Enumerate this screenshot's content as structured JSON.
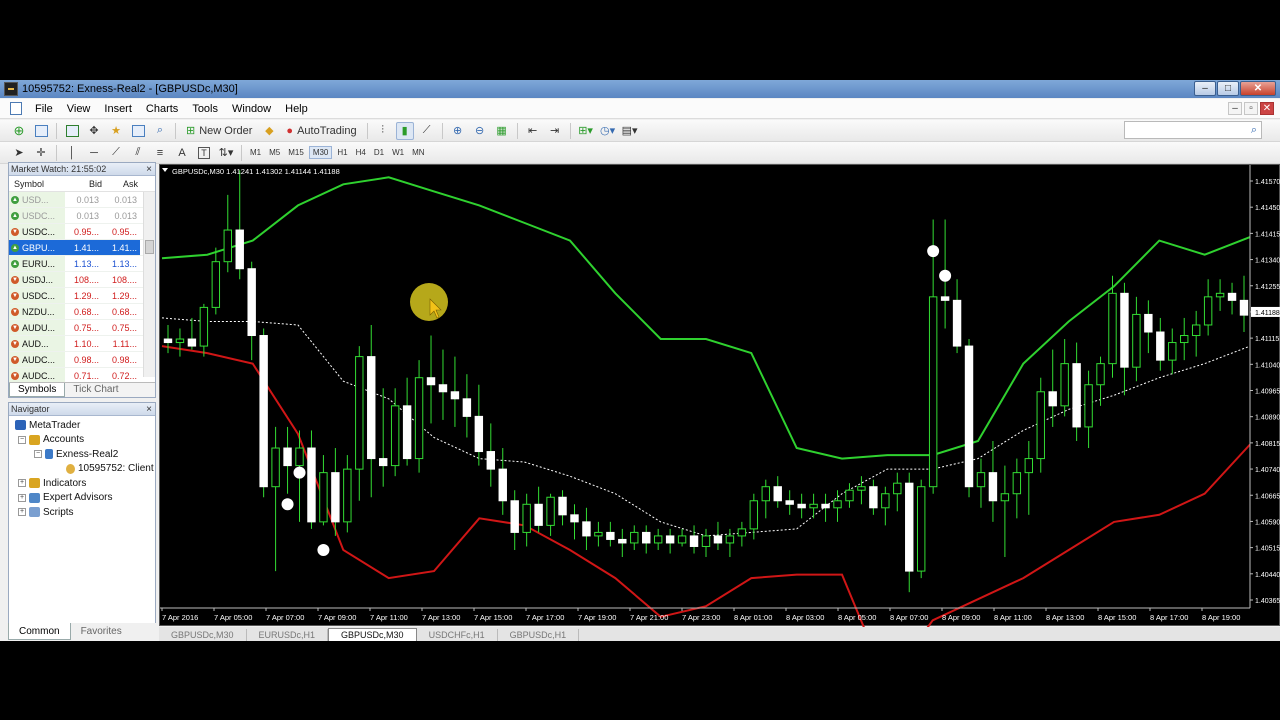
{
  "window": {
    "title": "10595752: Exness-Real2 - [GBPUSDc,M30]"
  },
  "menu": [
    "File",
    "View",
    "Insert",
    "Charts",
    "Tools",
    "Window",
    "Help"
  ],
  "toolbar": {
    "new_order": "New Order",
    "autotrading": "AutoTrading",
    "search_placeholder": ""
  },
  "timeframes": [
    "M1",
    "M5",
    "M15",
    "M30",
    "H1",
    "H4",
    "D1",
    "W1",
    "MN"
  ],
  "active_timeframe": "M30",
  "draw_tools": {
    "text": "A",
    "label": "T"
  },
  "market_watch": {
    "title": "Market Watch: 21:55:02",
    "columns": [
      "Symbol",
      "Bid",
      "Ask"
    ],
    "rows": [
      {
        "symbol": "USD...",
        "bid": "0.013",
        "ask": "0.013",
        "dir": "up",
        "dim": true
      },
      {
        "symbol": "USDC...",
        "bid": "0.013",
        "ask": "0.013",
        "dir": "up",
        "dim": true
      },
      {
        "symbol": "USDC...",
        "bid": "0.95...",
        "ask": "0.95...",
        "dir": "dn"
      },
      {
        "symbol": "GBPU...",
        "bid": "1.41...",
        "ask": "1.41...",
        "dir": "up",
        "selected": true
      },
      {
        "symbol": "EURU...",
        "bid": "1.13...",
        "ask": "1.13...",
        "dir": "up"
      },
      {
        "symbol": "USDJ...",
        "bid": "108....",
        "ask": "108....",
        "dir": "dn"
      },
      {
        "symbol": "USDC...",
        "bid": "1.29...",
        "ask": "1.29...",
        "dir": "dn"
      },
      {
        "symbol": "NZDU...",
        "bid": "0.68...",
        "ask": "0.68...",
        "dir": "dn"
      },
      {
        "symbol": "AUDU...",
        "bid": "0.75...",
        "ask": "0.75...",
        "dir": "dn"
      },
      {
        "symbol": "AUD...",
        "bid": "1.10...",
        "ask": "1.11...",
        "dir": "dn"
      },
      {
        "symbol": "AUDC...",
        "bid": "0.98...",
        "ask": "0.98...",
        "dir": "dn"
      },
      {
        "symbol": "AUDC...",
        "bid": "0.71...",
        "ask": "0.72...",
        "dir": "dn"
      }
    ],
    "tabs": [
      "Symbols",
      "Tick Chart"
    ]
  },
  "navigator": {
    "title": "Navigator",
    "items": [
      "MetaTrader",
      "Accounts",
      "Exness-Real2",
      "10595752: Client",
      "Indicators",
      "Expert Advisors",
      "Scripts"
    ]
  },
  "bottom_tabs": [
    "Common",
    "Favorites"
  ],
  "chart_tabs": [
    "GBPUSDc,M30",
    "EURUSDc,H1",
    "GBPUSDc,M30",
    "USDCHFc,H1",
    "GBPUSDc,H1"
  ],
  "active_chart_tab": 2,
  "chart_data": {
    "type": "candlestick",
    "symbol": "GBPUSDc,M30",
    "header": "GBPUSDc,M30  1.41241 1.41302 1.41144 1.41188",
    "current_price": "1.41188",
    "ylim": [
      1.40355,
      1.41615
    ],
    "y_ticks": [
      "1.41570",
      "1.41450",
      "1.41415",
      "1.41340",
      "1.41255",
      "1.41188",
      "1.41115",
      "1.41040",
      "1.40965",
      "1.40890",
      "1.40815",
      "1.40740",
      "1.40665",
      "1.40590",
      "1.40515",
      "1.40440",
      "1.40365"
    ],
    "x_ticks": [
      "7 Apr 2016",
      "7 Apr 05:00",
      "7 Apr 07:00",
      "7 Apr 09:00",
      "7 Apr 11:00",
      "7 Apr 13:00",
      "7 Apr 15:00",
      "7 Apr 17:00",
      "7 Apr 19:00",
      "7 Apr 21:00",
      "7 Apr 23:00",
      "8 Apr 01:00",
      "8 Apr 03:00",
      "8 Apr 05:00",
      "8 Apr 07:00",
      "8 Apr 09:00",
      "8 Apr 11:00",
      "8 Apr 13:00",
      "8 Apr 15:00",
      "8 Apr 17:00",
      "8 Apr 19:00"
    ],
    "candles": [
      {
        "o": 1.4112,
        "h": 1.4116,
        "l": 1.4108,
        "c": 1.4111
      },
      {
        "o": 1.4111,
        "h": 1.4115,
        "l": 1.4107,
        "c": 1.4112
      },
      {
        "o": 1.4112,
        "h": 1.4118,
        "l": 1.4109,
        "c": 1.411
      },
      {
        "o": 1.411,
        "h": 1.4122,
        "l": 1.4107,
        "c": 1.4121
      },
      {
        "o": 1.4121,
        "h": 1.4138,
        "l": 1.4119,
        "c": 1.4134
      },
      {
        "o": 1.4134,
        "h": 1.4153,
        "l": 1.4131,
        "c": 1.4143
      },
      {
        "o": 1.4143,
        "h": 1.416,
        "l": 1.4129,
        "c": 1.4132
      },
      {
        "o": 1.4132,
        "h": 1.4134,
        "l": 1.4106,
        "c": 1.4113
      },
      {
        "o": 1.4113,
        "h": 1.4115,
        "l": 1.4067,
        "c": 1.407
      },
      {
        "o": 1.407,
        "h": 1.4087,
        "l": 1.4046,
        "c": 1.4081
      },
      {
        "o": 1.4081,
        "h": 1.4087,
        "l": 1.4068,
        "c": 1.4076
      },
      {
        "o": 1.4076,
        "h": 1.4086,
        "l": 1.406,
        "c": 1.4081
      },
      {
        "o": 1.4081,
        "h": 1.4086,
        "l": 1.4058,
        "c": 1.406
      },
      {
        "o": 1.406,
        "h": 1.4079,
        "l": 1.4059,
        "c": 1.4074
      },
      {
        "o": 1.4074,
        "h": 1.4081,
        "l": 1.4056,
        "c": 1.406
      },
      {
        "o": 1.406,
        "h": 1.4079,
        "l": 1.4057,
        "c": 1.4075
      },
      {
        "o": 1.4075,
        "h": 1.411,
        "l": 1.4066,
        "c": 1.4107
      },
      {
        "o": 1.4107,
        "h": 1.4116,
        "l": 1.4067,
        "c": 1.4078
      },
      {
        "o": 1.4078,
        "h": 1.4098,
        "l": 1.407,
        "c": 1.4076
      },
      {
        "o": 1.4076,
        "h": 1.4098,
        "l": 1.4073,
        "c": 1.4093
      },
      {
        "o": 1.4093,
        "h": 1.4101,
        "l": 1.4076,
        "c": 1.4078
      },
      {
        "o": 1.4078,
        "h": 1.4106,
        "l": 1.4074,
        "c": 1.4101
      },
      {
        "o": 1.4101,
        "h": 1.4113,
        "l": 1.4088,
        "c": 1.4099
      },
      {
        "o": 1.4099,
        "h": 1.4109,
        "l": 1.4089,
        "c": 1.4097
      },
      {
        "o": 1.4097,
        "h": 1.4107,
        "l": 1.4087,
        "c": 1.4095
      },
      {
        "o": 1.4095,
        "h": 1.4102,
        "l": 1.4084,
        "c": 1.409
      },
      {
        "o": 1.409,
        "h": 1.4099,
        "l": 1.4076,
        "c": 1.408
      },
      {
        "o": 1.408,
        "h": 1.4088,
        "l": 1.407,
        "c": 1.4075
      },
      {
        "o": 1.4075,
        "h": 1.4081,
        "l": 1.4062,
        "c": 1.4066
      },
      {
        "o": 1.4066,
        "h": 1.4069,
        "l": 1.4052,
        "c": 1.4057
      },
      {
        "o": 1.4057,
        "h": 1.4068,
        "l": 1.4053,
        "c": 1.4065
      },
      {
        "o": 1.4065,
        "h": 1.407,
        "l": 1.4057,
        "c": 1.4059
      },
      {
        "o": 1.4059,
        "h": 1.4068,
        "l": 1.4056,
        "c": 1.4067
      },
      {
        "o": 1.4067,
        "h": 1.4069,
        "l": 1.4059,
        "c": 1.4062
      },
      {
        "o": 1.4062,
        "h": 1.4065,
        "l": 1.4055,
        "c": 1.406
      },
      {
        "o": 1.406,
        "h": 1.4064,
        "l": 1.4052,
        "c": 1.4056
      },
      {
        "o": 1.4056,
        "h": 1.406,
        "l": 1.4053,
        "c": 1.4057
      },
      {
        "o": 1.4057,
        "h": 1.406,
        "l": 1.4053,
        "c": 1.4055
      },
      {
        "o": 1.4055,
        "h": 1.4058,
        "l": 1.405,
        "c": 1.4054
      },
      {
        "o": 1.4054,
        "h": 1.4059,
        "l": 1.4052,
        "c": 1.4057
      },
      {
        "o": 1.4057,
        "h": 1.4059,
        "l": 1.4051,
        "c": 1.4054
      },
      {
        "o": 1.4054,
        "h": 1.4058,
        "l": 1.4052,
        "c": 1.4056
      },
      {
        "o": 1.4056,
        "h": 1.4058,
        "l": 1.4051,
        "c": 1.4054
      },
      {
        "o": 1.4054,
        "h": 1.4058,
        "l": 1.4053,
        "c": 1.4056
      },
      {
        "o": 1.4056,
        "h": 1.4059,
        "l": 1.4051,
        "c": 1.4053
      },
      {
        "o": 1.4053,
        "h": 1.4058,
        "l": 1.405,
        "c": 1.4056
      },
      {
        "o": 1.4056,
        "h": 1.406,
        "l": 1.4052,
        "c": 1.4054
      },
      {
        "o": 1.4054,
        "h": 1.4058,
        "l": 1.405,
        "c": 1.4056
      },
      {
        "o": 1.4056,
        "h": 1.406,
        "l": 1.4053,
        "c": 1.4058
      },
      {
        "o": 1.4058,
        "h": 1.4068,
        "l": 1.4055,
        "c": 1.4066
      },
      {
        "o": 1.4066,
        "h": 1.4072,
        "l": 1.4061,
        "c": 1.407
      },
      {
        "o": 1.407,
        "h": 1.4073,
        "l": 1.4064,
        "c": 1.4066
      },
      {
        "o": 1.4066,
        "h": 1.4069,
        "l": 1.4062,
        "c": 1.4065
      },
      {
        "o": 1.4065,
        "h": 1.4068,
        "l": 1.4061,
        "c": 1.4064
      },
      {
        "o": 1.4064,
        "h": 1.4068,
        "l": 1.4061,
        "c": 1.4065
      },
      {
        "o": 1.4065,
        "h": 1.4068,
        "l": 1.406,
        "c": 1.4064
      },
      {
        "o": 1.4064,
        "h": 1.4069,
        "l": 1.406,
        "c": 1.4066
      },
      {
        "o": 1.4066,
        "h": 1.4071,
        "l": 1.4064,
        "c": 1.4069
      },
      {
        "o": 1.4069,
        "h": 1.4073,
        "l": 1.4065,
        "c": 1.407
      },
      {
        "o": 1.407,
        "h": 1.4072,
        "l": 1.4062,
        "c": 1.4064
      },
      {
        "o": 1.4064,
        "h": 1.407,
        "l": 1.4059,
        "c": 1.4068
      },
      {
        "o": 1.4068,
        "h": 1.4074,
        "l": 1.4063,
        "c": 1.4071
      },
      {
        "o": 1.4071,
        "h": 1.4074,
        "l": 1.404,
        "c": 1.4046
      },
      {
        "o": 1.4046,
        "h": 1.4072,
        "l": 1.4044,
        "c": 1.407
      },
      {
        "o": 1.407,
        "h": 1.4146,
        "l": 1.4068,
        "c": 1.4124
      },
      {
        "o": 1.4124,
        "h": 1.4146,
        "l": 1.4115,
        "c": 1.4123
      },
      {
        "o": 1.4123,
        "h": 1.4129,
        "l": 1.4108,
        "c": 1.411
      },
      {
        "o": 1.411,
        "h": 1.4112,
        "l": 1.4067,
        "c": 1.407
      },
      {
        "o": 1.407,
        "h": 1.4078,
        "l": 1.4064,
        "c": 1.4074
      },
      {
        "o": 1.4074,
        "h": 1.4083,
        "l": 1.406,
        "c": 1.4066
      },
      {
        "o": 1.4066,
        "h": 1.4076,
        "l": 1.405,
        "c": 1.4068
      },
      {
        "o": 1.4068,
        "h": 1.4078,
        "l": 1.4061,
        "c": 1.4074
      },
      {
        "o": 1.4074,
        "h": 1.4083,
        "l": 1.4062,
        "c": 1.4078
      },
      {
        "o": 1.4078,
        "h": 1.4101,
        "l": 1.4074,
        "c": 1.4097
      },
      {
        "o": 1.4097,
        "h": 1.4109,
        "l": 1.4087,
        "c": 1.4093
      },
      {
        "o": 1.4093,
        "h": 1.4112,
        "l": 1.409,
        "c": 1.4105
      },
      {
        "o": 1.4105,
        "h": 1.4111,
        "l": 1.4083,
        "c": 1.4087
      },
      {
        "o": 1.4087,
        "h": 1.4103,
        "l": 1.4081,
        "c": 1.4099
      },
      {
        "o": 1.4099,
        "h": 1.4107,
        "l": 1.4093,
        "c": 1.4105
      },
      {
        "o": 1.4105,
        "h": 1.413,
        "l": 1.4101,
        "c": 1.4125
      },
      {
        "o": 1.4125,
        "h": 1.4128,
        "l": 1.4096,
        "c": 1.4104
      },
      {
        "o": 1.4104,
        "h": 1.4124,
        "l": 1.41,
        "c": 1.4119
      },
      {
        "o": 1.4119,
        "h": 1.4123,
        "l": 1.4108,
        "c": 1.4114
      },
      {
        "o": 1.4114,
        "h": 1.4118,
        "l": 1.4103,
        "c": 1.4106
      },
      {
        "o": 1.4106,
        "h": 1.4115,
        "l": 1.4102,
        "c": 1.4111
      },
      {
        "o": 1.4111,
        "h": 1.4118,
        "l": 1.4106,
        "c": 1.4113
      },
      {
        "o": 1.4113,
        "h": 1.412,
        "l": 1.4107,
        "c": 1.4116
      },
      {
        "o": 1.4116,
        "h": 1.4129,
        "l": 1.4113,
        "c": 1.4124
      },
      {
        "o": 1.4124,
        "h": 1.4129,
        "l": 1.412,
        "c": 1.4125
      },
      {
        "o": 1.4125,
        "h": 1.4128,
        "l": 1.4119,
        "c": 1.4123
      },
      {
        "o": 1.4123,
        "h": 1.413,
        "l": 1.4114,
        "c": 1.41188
      }
    ],
    "bb_upper": [
      1.4135,
      1.4136,
      1.414,
      1.415,
      1.4156,
      1.4158,
      1.4154,
      1.415,
      1.4145,
      1.414,
      1.4125,
      1.4112,
      1.4112,
      1.4108,
      1.4081,
      1.4078,
      1.4079,
      1.4079,
      1.4083,
      1.4105,
      1.4117,
      1.4127,
      1.414,
      1.4136,
      1.4141
    ],
    "bb_middle": [
      1.4118,
      1.4117,
      1.4117,
      1.4116,
      1.41,
      1.4095,
      1.4084,
      1.4078,
      1.4077,
      1.4073,
      1.4068,
      1.406,
      1.4056,
      1.4057,
      1.4058,
      1.4068,
      1.4075,
      1.4075,
      1.4078,
      1.4086,
      1.4092,
      1.4096,
      1.4101,
      1.4105,
      1.411
    ],
    "bb_lower": [
      1.411,
      1.4108,
      1.4105,
      1.4085,
      1.4052,
      1.4044,
      1.4046,
      1.4061,
      1.4059,
      1.4052,
      1.4044,
      1.4033,
      1.4036,
      1.4044,
      1.4045,
      1.4045,
      1.4014,
      1.4032,
      1.4038,
      1.4044,
      1.4052,
      1.406,
      1.4062,
      1.4068,
      1.4082
    ],
    "signals": [
      {
        "bar": 10,
        "price": 1.4065
      },
      {
        "bar": 11,
        "price": 1.4074
      },
      {
        "bar": 13,
        "price": 1.4052
      },
      {
        "bar": 64,
        "price": 1.4137
      },
      {
        "bar": 65,
        "price": 1.413
      }
    ]
  },
  "colors": {
    "upper_band": "#2fd12f",
    "lower_band": "#d01616",
    "middle_band": "#ffffff",
    "candle": "#ffffff",
    "wick": "#33dd33",
    "background": "#000000",
    "selected": "#1c6ad8"
  }
}
